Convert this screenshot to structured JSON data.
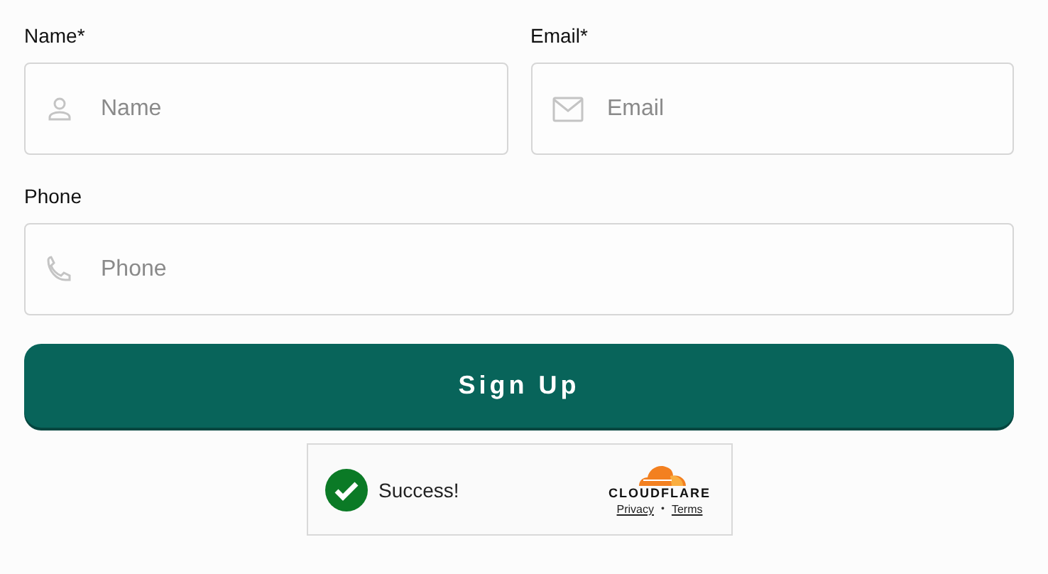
{
  "rows": [
    {
      "fields": [
        {
          "label": "Name*",
          "placeholder": "Name",
          "kind": "person"
        },
        {
          "label": "Email*",
          "placeholder": "Email",
          "kind": "mail"
        }
      ]
    },
    {
      "fields": [
        {
          "label": "Phone",
          "placeholder": "Phone",
          "kind": "phone"
        }
      ]
    }
  ],
  "submit": {
    "label": "Sign Up"
  },
  "captcha": {
    "status": "Success!",
    "brand": "CLOUDFLARE",
    "links": [
      "Privacy",
      "Terms"
    ],
    "separator": "•"
  }
}
